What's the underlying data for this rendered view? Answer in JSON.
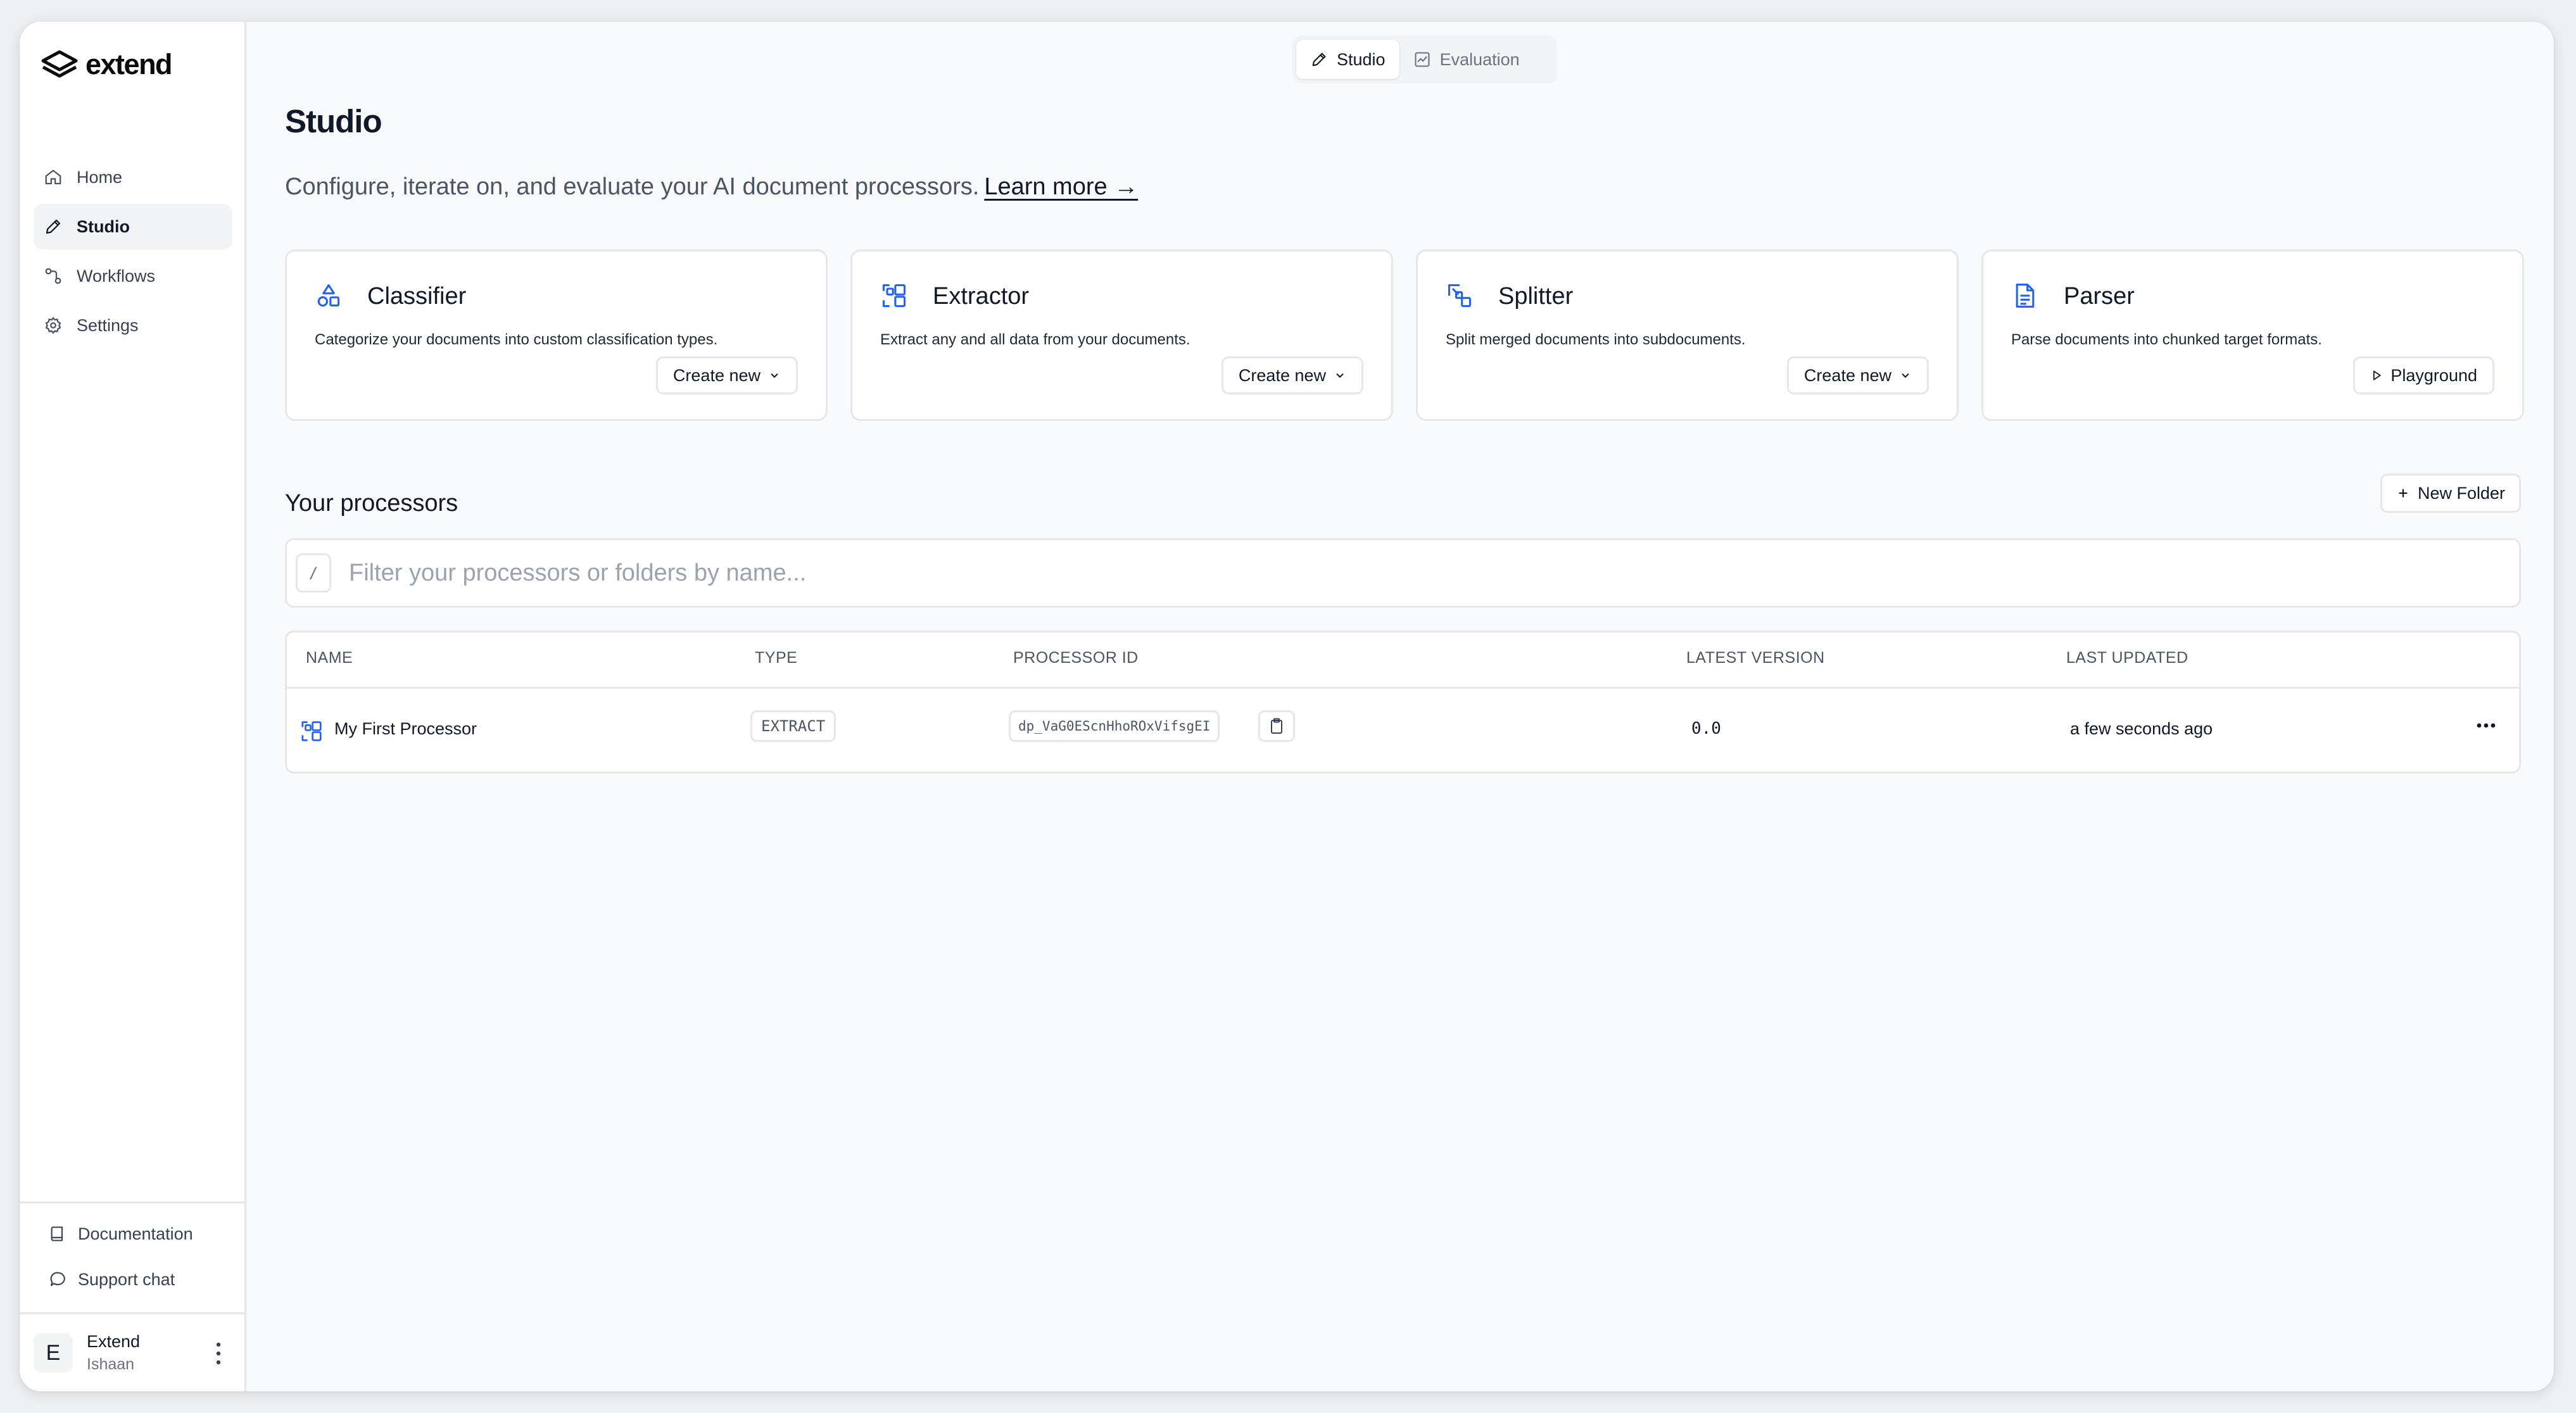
{
  "app": {
    "name": "extend"
  },
  "sidebar": {
    "items": [
      {
        "label": "Home",
        "icon": "home-icon",
        "active": false
      },
      {
        "label": "Studio",
        "icon": "pencil-icon",
        "active": true
      },
      {
        "label": "Workflows",
        "icon": "workflow-icon",
        "active": false
      },
      {
        "label": "Settings",
        "icon": "gear-icon",
        "active": false
      }
    ],
    "documentation": "Documentation",
    "support_chat": "Support chat",
    "user": {
      "initial": "E",
      "org": "Extend",
      "name": "Ishaan"
    }
  },
  "mode_toggle": {
    "studio": "Studio",
    "evaluation": "Evaluation"
  },
  "page": {
    "title": "Studio",
    "description": "Configure, iterate on, and evaluate your AI document processors.",
    "learn_more": "Learn more →"
  },
  "cards": [
    {
      "title": "Classifier",
      "description": "Categorize your documents into custom classification types.",
      "button": "Create new",
      "icon": "shapes-icon"
    },
    {
      "title": "Extractor",
      "description": "Extract any and all data from your documents.",
      "button": "Create new",
      "icon": "extract-icon"
    },
    {
      "title": "Splitter",
      "description": "Split merged documents into subdocuments.",
      "button": "Create new",
      "icon": "split-icon"
    },
    {
      "title": "Parser",
      "description": "Parse documents into chunked target formats.",
      "button": "Playground",
      "icon": "document-icon"
    }
  ],
  "processors": {
    "title": "Your processors",
    "new_folder": "New Folder",
    "filter_key": "/",
    "filter_placeholder": "Filter your processors or folders by name...",
    "columns": [
      "NAME",
      "TYPE",
      "PROCESSOR ID",
      "LATEST VERSION",
      "LAST UPDATED"
    ],
    "rows": [
      {
        "name": "My First Processor",
        "type": "EXTRACT",
        "id": "dp_VaG0EScnHhoROxVifsgEI",
        "version": "0.0",
        "updated": "a few seconds ago"
      }
    ]
  },
  "colors": {
    "accent": "#2563eb",
    "text": "#111827",
    "muted": "#6b7280",
    "border": "#e5e7eb"
  }
}
